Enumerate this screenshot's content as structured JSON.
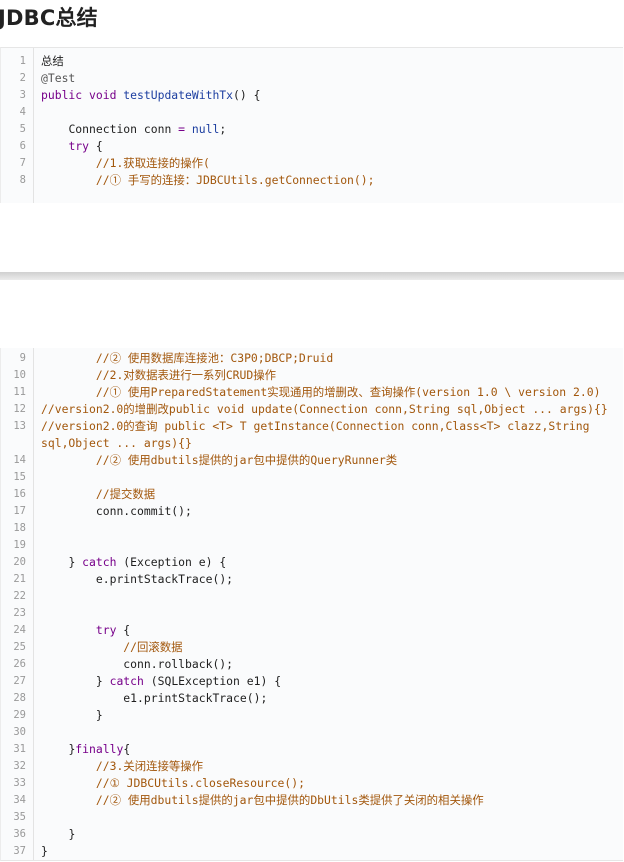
{
  "title": "JDBC总结",
  "block_a": [
    {
      "n": "1",
      "segs": [
        {
          "t": "总结",
          "c": ""
        }
      ]
    },
    {
      "n": "2",
      "segs": [
        {
          "t": "@Test",
          "c": "ann"
        }
      ]
    },
    {
      "n": "3",
      "segs": [
        {
          "t": "public void ",
          "c": "kw"
        },
        {
          "t": "testUpdateWithTx",
          "c": "fn"
        },
        {
          "t": "() {",
          "c": ""
        }
      ]
    },
    {
      "n": "4",
      "segs": []
    },
    {
      "n": "5",
      "segs": [
        {
          "t": "    Connection conn ",
          "c": ""
        },
        {
          "t": "=",
          "c": "kw"
        },
        {
          "t": " ",
          "c": ""
        },
        {
          "t": "null",
          "c": "lit"
        },
        {
          "t": ";",
          "c": ""
        }
      ]
    },
    {
      "n": "6",
      "segs": [
        {
          "t": "    ",
          "c": ""
        },
        {
          "t": "try",
          "c": "kw"
        },
        {
          "t": " {",
          "c": ""
        }
      ]
    },
    {
      "n": "7",
      "segs": [
        {
          "t": "        //1.获取连接的操作(",
          "c": "cm"
        }
      ]
    },
    {
      "n": "8",
      "segs": [
        {
          "t": "        //① 手写的连接：JDBCUtils.getConnection();",
          "c": "cm"
        }
      ]
    }
  ],
  "block_b": [
    {
      "n": "9",
      "segs": [
        {
          "t": "        //② 使用数据库连接池：C3P0;DBCP;Druid",
          "c": "cm"
        }
      ]
    },
    {
      "n": "10",
      "segs": [
        {
          "t": "        //2.对数据表进行一系列CRUD操作",
          "c": "cm"
        }
      ]
    },
    {
      "n": "11",
      "segs": [
        {
          "t": "        //① 使用PreparedStatement实现通用的增删改、查询操作(version 1.0 \\ version 2.0)",
          "c": "cm"
        }
      ]
    },
    {
      "n": "12",
      "segs": [
        {
          "t": "//version2.0的增删改public void update(Connection conn,String sql,Object ... args){}",
          "c": "cm"
        }
      ]
    },
    {
      "n": "13",
      "wrap": true,
      "segs": [
        {
          "t": "//version2.0的查询 public <T> T getInstance(Connection conn,Class<T> clazz,String sql,Object ... args){}",
          "c": "cm"
        }
      ]
    },
    {
      "n": "14",
      "segs": [
        {
          "t": "        //② 使用dbutils提供的jar包中提供的QueryRunner类",
          "c": "cm"
        }
      ]
    },
    {
      "n": "15",
      "segs": []
    },
    {
      "n": "16",
      "segs": [
        {
          "t": "        //提交数据",
          "c": "cm"
        }
      ]
    },
    {
      "n": "17",
      "segs": [
        {
          "t": "        conn.commit();",
          "c": ""
        }
      ]
    },
    {
      "n": "18",
      "segs": []
    },
    {
      "n": "19",
      "segs": []
    },
    {
      "n": "20",
      "segs": [
        {
          "t": "    } ",
          "c": ""
        },
        {
          "t": "catch",
          "c": "kw"
        },
        {
          "t": " (Exception e) {",
          "c": ""
        }
      ]
    },
    {
      "n": "21",
      "segs": [
        {
          "t": "        e.printStackTrace();",
          "c": ""
        }
      ]
    },
    {
      "n": "22",
      "segs": []
    },
    {
      "n": "23",
      "segs": []
    },
    {
      "n": "24",
      "segs": [
        {
          "t": "        ",
          "c": ""
        },
        {
          "t": "try",
          "c": "kw"
        },
        {
          "t": " {",
          "c": ""
        }
      ]
    },
    {
      "n": "25",
      "segs": [
        {
          "t": "            //回滚数据",
          "c": "cm"
        }
      ]
    },
    {
      "n": "26",
      "segs": [
        {
          "t": "            conn.rollback();",
          "c": ""
        }
      ]
    },
    {
      "n": "27",
      "segs": [
        {
          "t": "        } ",
          "c": ""
        },
        {
          "t": "catch",
          "c": "kw"
        },
        {
          "t": " (SQLException e1) {",
          "c": ""
        }
      ]
    },
    {
      "n": "28",
      "segs": [
        {
          "t": "            e1.printStackTrace();",
          "c": ""
        }
      ]
    },
    {
      "n": "29",
      "segs": [
        {
          "t": "        }",
          "c": ""
        }
      ]
    },
    {
      "n": "30",
      "segs": []
    },
    {
      "n": "31",
      "segs": [
        {
          "t": "    }",
          "c": ""
        },
        {
          "t": "finally",
          "c": "kw"
        },
        {
          "t": "{",
          "c": ""
        }
      ]
    },
    {
      "n": "32",
      "segs": [
        {
          "t": "        //3.关闭连接等操作",
          "c": "cm"
        }
      ]
    },
    {
      "n": "33",
      "segs": [
        {
          "t": "        //① JDBCUtils.closeResource();",
          "c": "cm"
        }
      ]
    },
    {
      "n": "34",
      "segs": [
        {
          "t": "        //② 使用dbutils提供的jar包中提供的DbUtils类提供了关闭的相关操作",
          "c": "cm"
        }
      ]
    },
    {
      "n": "35",
      "segs": []
    },
    {
      "n": "36",
      "segs": [
        {
          "t": "    }",
          "c": ""
        }
      ]
    },
    {
      "n": "37",
      "segs": [
        {
          "t": "}",
          "c": ""
        }
      ]
    }
  ]
}
